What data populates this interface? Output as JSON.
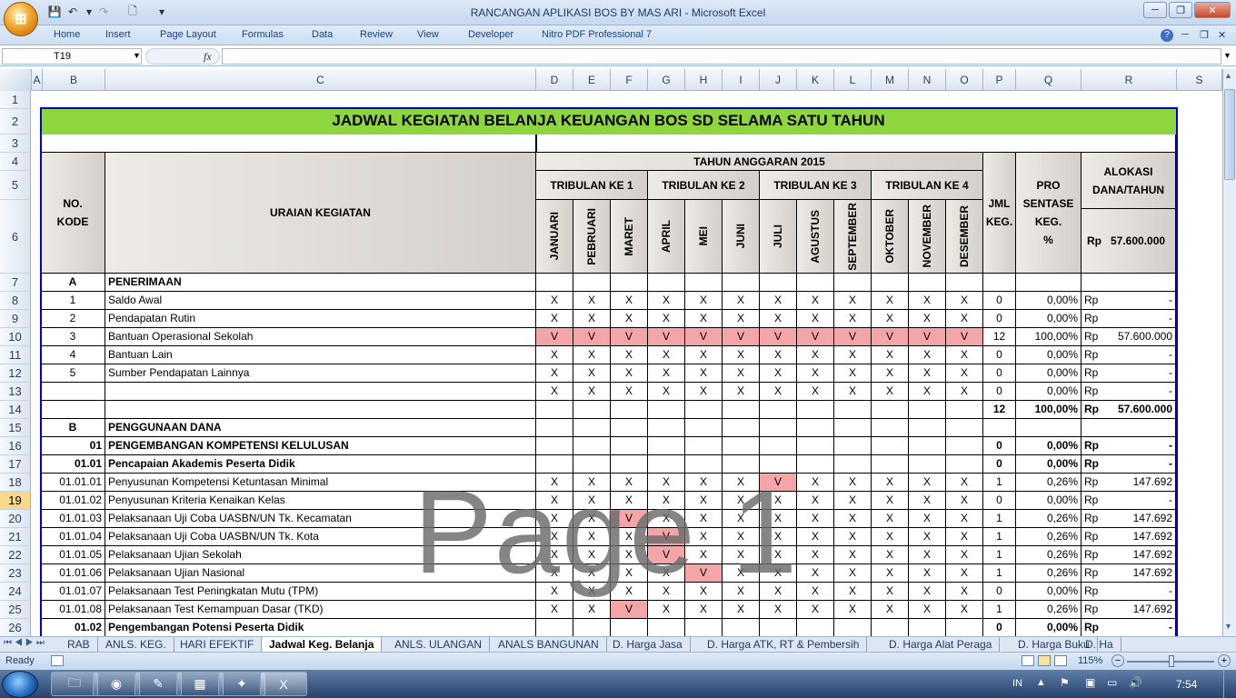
{
  "app": {
    "title": "RANCANGAN APLIKASI BOS BY MAS ARI - Microsoft Excel"
  },
  "ribbon_tabs": [
    "Home",
    "Insert",
    "Page Layout",
    "Formulas",
    "Data",
    "Review",
    "View",
    "Developer",
    "Nitro PDF Professional 7"
  ],
  "formula_bar": {
    "name_box": "T19",
    "fx": "fx",
    "formula": ""
  },
  "columns": [
    "A",
    "B",
    "C",
    "D",
    "E",
    "F",
    "G",
    "H",
    "I",
    "J",
    "K",
    "L",
    "M",
    "N",
    "O",
    "P",
    "Q",
    "R",
    "S"
  ],
  "rows": [
    "1",
    "2",
    "3",
    "4",
    "5",
    "6",
    "7",
    "8",
    "9",
    "10",
    "11",
    "12",
    "13",
    "14",
    "15",
    "16",
    "17",
    "18",
    "19",
    "20",
    "21",
    "22",
    "23",
    "24",
    "25",
    "26"
  ],
  "selected_row": "19",
  "sheet": {
    "title": "JADWAL KEGIATAN BELANJA KEUANGAN BOS SD SELAMA SATU TAHUN",
    "hdr_no": "NO.\nKODE",
    "hdr_uraian": "URAIAN KEGIATAN",
    "hdr_tahun": "TAHUN ANGGARAN 2015",
    "triwulan": [
      "TRIBULAN KE 1",
      "TRIBULAN KE 2",
      "TRIBULAN KE 3",
      "TRIBULAN KE 4"
    ],
    "months": [
      "JANUARI",
      "PEBRUARI",
      "MARET",
      "APRIL",
      "MEI",
      "JUNI",
      "JULI",
      "AGUSTUS",
      "SEPTEMBER",
      "OKTOBER",
      "NOVEMBER",
      "DESEMBER"
    ],
    "hdr_jml": "JML\nKEG.",
    "hdr_pro": "PRO\nSENTASE\nKEG.\n%",
    "hdr_alokasi": "ALOKASI\nDANA/TAHUN",
    "alokasi_total_rp": "Rp",
    "alokasi_total": "57.600.000"
  },
  "data_rows": [
    {
      "code": "A",
      "name": "PENERIMAAN",
      "bold": true,
      "marks": "",
      "jml": "",
      "pct": "",
      "rp": "",
      "amt": ""
    },
    {
      "code": "1",
      "name": "Saldo Awal",
      "marks": "XXXXXXXXXXXX",
      "jml": "0",
      "pct": "0,00%",
      "rp": "Rp",
      "amt": "-"
    },
    {
      "code": "2",
      "name": "Pendapatan Rutin",
      "marks": "XXXXXXXXXXXX",
      "jml": "0",
      "pct": "0,00%",
      "rp": "Rp",
      "amt": "-"
    },
    {
      "code": "3",
      "name": "Bantuan Operasional Sekolah",
      "marks": "VVVVVVVVVVVV",
      "jml": "12",
      "pct": "100,00%",
      "rp": "Rp",
      "amt": "57.600.000"
    },
    {
      "code": "4",
      "name": "Bantuan Lain",
      "marks": "XXXXXXXXXXXX",
      "jml": "0",
      "pct": "0,00%",
      "rp": "Rp",
      "amt": "-"
    },
    {
      "code": "5",
      "name": "Sumber Pendapatan Lainnya",
      "marks": "XXXXXXXXXXXX",
      "jml": "0",
      "pct": "0,00%",
      "rp": "Rp",
      "amt": "-"
    },
    {
      "code": "",
      "name": "",
      "marks": "XXXXXXXXXXXX",
      "jml": "0",
      "pct": "0,00%",
      "rp": "Rp",
      "amt": "-"
    },
    {
      "code": "",
      "name": "",
      "marks": "",
      "jml": "12",
      "pct": "100,00%",
      "rp": "Rp",
      "amt": "57.600.000",
      "bold": true
    },
    {
      "code": "B",
      "name": "PENGGUNAAN DANA",
      "bold": true,
      "marks": "",
      "jml": "",
      "pct": "",
      "rp": "",
      "amt": ""
    },
    {
      "code": "01",
      "name": "PENGEMBANGAN KOMPETENSI KELULUSAN",
      "bold": true,
      "codeRight": true,
      "marks": "",
      "jml": "0",
      "pct": "0,00%",
      "rp": "Rp",
      "amt": "-"
    },
    {
      "code": "01.01",
      "name": "Pencapaian Akademis Peserta Didik",
      "bold": true,
      "codeRight": true,
      "marks": "",
      "jml": "0",
      "pct": "0,00%",
      "rp": "Rp",
      "amt": "-"
    },
    {
      "code": "01.01.01",
      "name": "Penyusunan Kompetensi Ketuntasan Minimal",
      "codeRight": true,
      "marks": "XXXXXXVXXXXX",
      "jml": "1",
      "pct": "0,26%",
      "rp": "Rp",
      "amt": "147.692"
    },
    {
      "code": "01.01.02",
      "name": "Penyusunan Kriteria Kenaikan Kelas",
      "codeRight": true,
      "marks": "XXXXXXXXXXXX",
      "jml": "0",
      "pct": "0,00%",
      "rp": "Rp",
      "amt": "-"
    },
    {
      "code": "01.01.03",
      "name": "Pelaksanaan Uji Coba UASBN/UN Tk. Kecamatan",
      "codeRight": true,
      "marks": "XXVXXXXXXXXX",
      "jml": "1",
      "pct": "0,26%",
      "rp": "Rp",
      "amt": "147.692"
    },
    {
      "code": "01.01.04",
      "name": "Pelaksanaan Uji Coba UASBN/UN Tk. Kota",
      "codeRight": true,
      "marks": "XXXVXXXXXXXX",
      "jml": "1",
      "pct": "0,26%",
      "rp": "Rp",
      "amt": "147.692"
    },
    {
      "code": "01.01.05",
      "name": "Pelaksanaan Ujian Sekolah",
      "codeRight": true,
      "marks": "XXXVXXXXXXXX",
      "jml": "1",
      "pct": "0,26%",
      "rp": "Rp",
      "amt": "147.692"
    },
    {
      "code": "01.01.06",
      "name": "Pelaksanaan Ujian Nasional",
      "codeRight": true,
      "marks": "XXXXVXXXXXXX",
      "jml": "1",
      "pct": "0,26%",
      "rp": "Rp",
      "amt": "147.692"
    },
    {
      "code": "01.01.07",
      "name": "Pelaksanaan Test Peningkatan Mutu (TPM)",
      "codeRight": true,
      "marks": "XXXXXXXXXXXX",
      "jml": "0",
      "pct": "0,00%",
      "rp": "Rp",
      "amt": "-"
    },
    {
      "code": "01.01.08",
      "name": "Pelaksanaan Test Kemampuan Dasar (TKD)",
      "codeRight": true,
      "marks": "XXVXXXXXXXXX",
      "jml": "1",
      "pct": "0,26%",
      "rp": "Rp",
      "amt": "147.692"
    },
    {
      "code": "01.02",
      "name": "Pengembangan Potensi Peserta Didik",
      "bold": true,
      "codeRight": true,
      "marks": "",
      "jml": "0",
      "pct": "0,00%",
      "rp": "Rp",
      "amt": "-"
    }
  ],
  "watermark": "Page 1",
  "sheet_tabs": [
    "RAB",
    "ANLS. KEG.",
    "HARI EFEKTIF",
    "Jadwal Keg. Belanja",
    "ANLS. ULANGAN",
    "ANALS BANGUNAN",
    "D. Harga Jasa",
    "D. Harga ATK, RT & Pembersih",
    "D. Harga Alat Peraga",
    "D. Harga Buku",
    "D. Ha"
  ],
  "active_sheet": "Jadwal Keg. Belanja",
  "status": {
    "ready": "Ready",
    "zoom": "115%"
  },
  "taskbar": {
    "lang": "IN",
    "time": "7:54"
  },
  "colors": {
    "pink": "#f4a5a8",
    "title_green": "#8ed63f",
    "border_blue": "#0000cc"
  }
}
